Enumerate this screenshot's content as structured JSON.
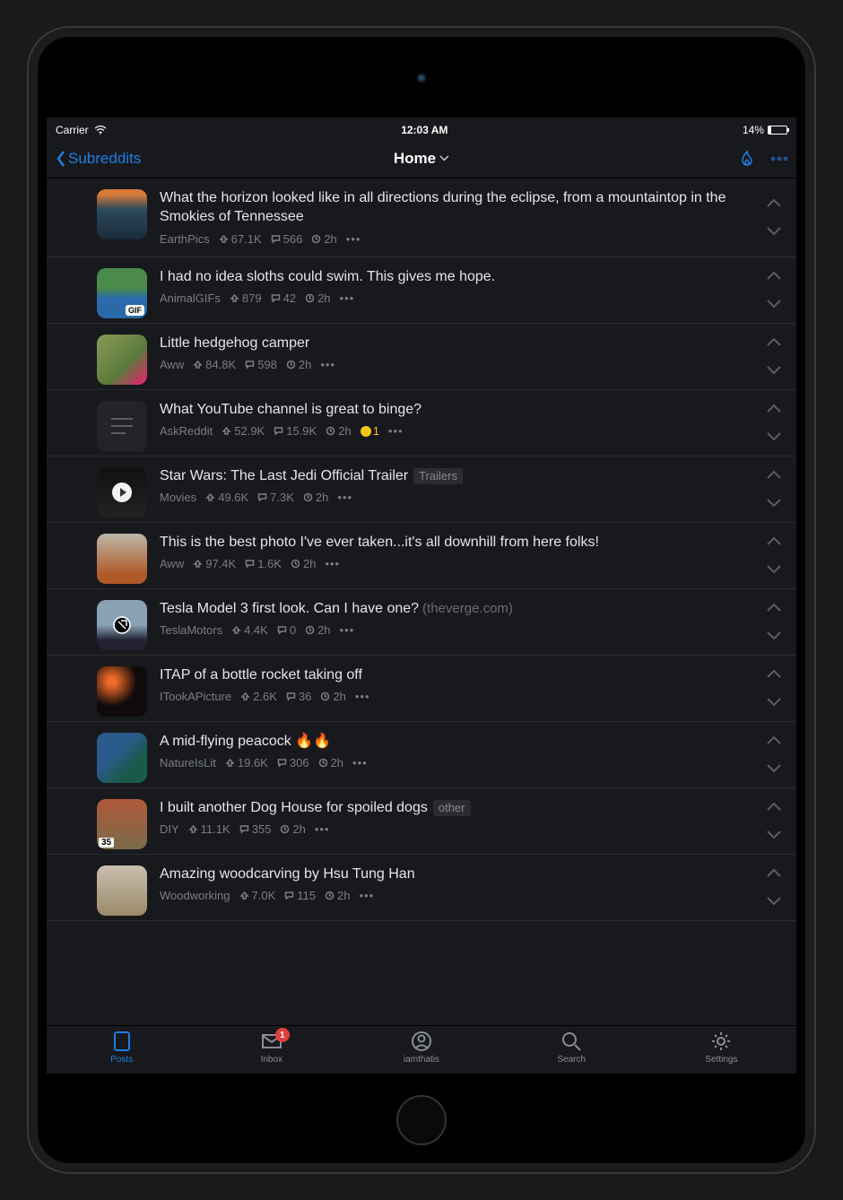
{
  "status": {
    "carrier": "Carrier",
    "time": "12:03 AM",
    "battery": "14%"
  },
  "nav": {
    "back": "Subreddits",
    "title": "Home"
  },
  "posts": [
    {
      "title": "What the horizon looked like in all directions during the eclipse, from a mountaintop in the Smokies of Tennessee",
      "sub": "EarthPics",
      "score": "67.1K",
      "comments": "566",
      "age": "2h",
      "thumb_bg": "linear-gradient(180deg,#d97a3a 10%,#2a4a5a 40%,#1a2a3a 100%)"
    },
    {
      "title": "I had no idea sloths could swim. This gives me hope.",
      "sub": "AnimalGIFs",
      "score": "879",
      "comments": "42",
      "age": "2h",
      "gif": true,
      "thumb_bg": "linear-gradient(180deg,#4a8a4a 40%,#2a6aaa 60%)"
    },
    {
      "title": "Little hedgehog camper",
      "sub": "Aww",
      "score": "84.8K",
      "comments": "598",
      "age": "2h",
      "thumb_bg": "linear-gradient(135deg,#8a9a5a,#5a7a3a 60%,#c36 90%)"
    },
    {
      "title": "What YouTube channel is great to binge?",
      "sub": "AskReddit",
      "score": "52.9K",
      "comments": "15.9K",
      "age": "2h",
      "award": "1",
      "thumb_type": "text"
    },
    {
      "title": "Star Wars: The Last Jedi Official Trailer",
      "sub": "Movies",
      "score": "49.6K",
      "comments": "7.3K",
      "age": "2h",
      "flair": "Trailers",
      "play": true,
      "thumb_bg": "linear-gradient(180deg,#111,#222)"
    },
    {
      "title": "This is the best photo I've ever taken...it's all downhill from here folks!",
      "sub": "Aww",
      "score": "97.4K",
      "comments": "1.6K",
      "age": "2h",
      "thumb_bg": "linear-gradient(180deg,#bcb8a8,#b05a2a 80%)"
    },
    {
      "title": "Tesla Model 3 first look. Can I have one?",
      "sub": "TeslaMotors",
      "score": "4.4K",
      "comments": "0",
      "age": "2h",
      "domain": "(theverge.com)",
      "link": true,
      "thumb_bg": "linear-gradient(180deg,#8aa0b5 50%,#223 80%)"
    },
    {
      "title": "ITAP of a bottle rocket taking off",
      "sub": "ITookAPicture",
      "score": "2.6K",
      "comments": "36",
      "age": "2h",
      "thumb_bg": "radial-gradient(circle at 30% 30%,#f06a2a 8%,#100a0a 50%)"
    },
    {
      "title": "A mid-flying peacock 🔥🔥",
      "sub": "NatureIsLit",
      "score": "19.6K",
      "comments": "306",
      "age": "2h",
      "thumb_bg": "linear-gradient(135deg,#2a5a8a 40%,#1a5a4a 70%)"
    },
    {
      "title": "I built another Dog House for spoiled dogs",
      "sub": "DIY",
      "score": "11.1K",
      "comments": "355",
      "age": "2h",
      "flair": "other",
      "count": "35",
      "thumb_bg": "linear-gradient(180deg,#b05a3a,#7a6a4a)"
    },
    {
      "title": "Amazing woodcarving by Hsu Tung Han",
      "sub": "Woodworking",
      "score": "7.0K",
      "comments": "115",
      "age": "2h",
      "thumb_bg": "linear-gradient(180deg,#cabfae,#9a8a6a)"
    }
  ],
  "tabs": {
    "posts": "Posts",
    "inbox": "Inbox",
    "inbox_badge": "1",
    "account": "iamthatis",
    "search": "Search",
    "settings": "Settings"
  }
}
